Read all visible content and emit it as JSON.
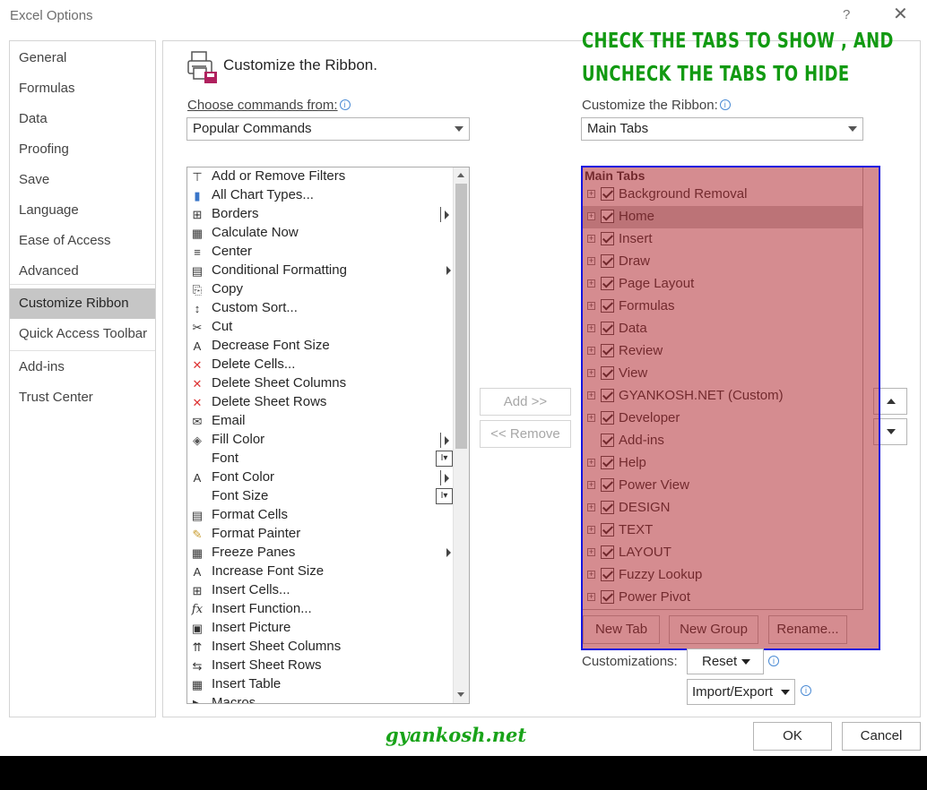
{
  "window": {
    "title": "Excel Options",
    "help": "?",
    "close": "✕"
  },
  "nav": {
    "items": [
      {
        "label": "General"
      },
      {
        "label": "Formulas"
      },
      {
        "label": "Data"
      },
      {
        "label": "Proofing"
      },
      {
        "label": "Save"
      },
      {
        "label": "Language"
      },
      {
        "label": "Ease of Access"
      },
      {
        "label": "Advanced"
      },
      {
        "label": "Customize Ribbon",
        "active": true
      },
      {
        "label": "Quick Access Toolbar"
      },
      {
        "label": "Add-ins"
      },
      {
        "label": "Trust Center"
      }
    ]
  },
  "main": {
    "heading": "Customize the Ribbon.",
    "choose_label": "Choose commands from:",
    "choose_value": "Popular Commands",
    "customize_label": "Customize the Ribbon:",
    "customize_value": "Main Tabs",
    "add_button": "Add >>",
    "remove_button": "<< Remove",
    "commands": [
      {
        "label": "Add or Remove Filters",
        "icon": "filter-icon",
        "glyph": "⊤"
      },
      {
        "label": "All Chart Types...",
        "icon": "chart-icon",
        "glyph": "▮"
      },
      {
        "label": "Borders",
        "icon": "borders-icon",
        "glyph": "⊞",
        "extra": "subbar"
      },
      {
        "label": "Calculate Now",
        "icon": "calculator-icon",
        "glyph": "▦"
      },
      {
        "label": "Center",
        "icon": "align-center-icon",
        "glyph": "≡"
      },
      {
        "label": "Conditional Formatting",
        "icon": "conditional-format-icon",
        "glyph": "▤",
        "extra": "sub"
      },
      {
        "label": "Copy",
        "icon": "copy-icon",
        "glyph": "⎘"
      },
      {
        "label": "Custom Sort...",
        "icon": "sort-icon",
        "glyph": "↕"
      },
      {
        "label": "Cut",
        "icon": "scissors-icon",
        "glyph": "✂"
      },
      {
        "label": "Decrease Font Size",
        "icon": "decrease-font-icon",
        "glyph": "A"
      },
      {
        "label": "Delete Cells...",
        "icon": "delete-cells-icon",
        "glyph": "✕"
      },
      {
        "label": "Delete Sheet Columns",
        "icon": "delete-columns-icon",
        "glyph": "✕"
      },
      {
        "label": "Delete Sheet Rows",
        "icon": "delete-rows-icon",
        "glyph": "✕"
      },
      {
        "label": "Email",
        "icon": "email-icon",
        "glyph": "✉"
      },
      {
        "label": "Fill Color",
        "icon": "fill-color-icon",
        "glyph": "◈",
        "extra": "subbar"
      },
      {
        "label": "Font",
        "icon": "font-icon",
        "glyph": "",
        "extra": "combo"
      },
      {
        "label": "Font Color",
        "icon": "font-color-icon",
        "glyph": "A",
        "extra": "subbar"
      },
      {
        "label": "Font Size",
        "icon": "font-size-icon",
        "glyph": "",
        "extra": "combo"
      },
      {
        "label": "Format Cells",
        "icon": "format-cells-icon",
        "glyph": "▤"
      },
      {
        "label": "Format Painter",
        "icon": "format-painter-icon",
        "glyph": "✎"
      },
      {
        "label": "Freeze Panes",
        "icon": "freeze-panes-icon",
        "glyph": "▦",
        "extra": "sub"
      },
      {
        "label": "Increase Font Size",
        "icon": "increase-font-icon",
        "glyph": "A"
      },
      {
        "label": "Insert Cells...",
        "icon": "insert-cells-icon",
        "glyph": "⊞"
      },
      {
        "label": "Insert Function...",
        "icon": "function-icon",
        "glyph": "fx"
      },
      {
        "label": "Insert Picture",
        "icon": "picture-icon",
        "glyph": "▣"
      },
      {
        "label": "Insert Sheet Columns",
        "icon": "insert-columns-icon",
        "glyph": "⇈"
      },
      {
        "label": "Insert Sheet Rows",
        "icon": "insert-rows-icon",
        "glyph": "⇆"
      },
      {
        "label": "Insert Table",
        "icon": "table-icon",
        "glyph": "▦"
      },
      {
        "label": "Macros",
        "icon": "macros-icon",
        "glyph": "▶"
      }
    ],
    "tabs_header": "Main Tabs",
    "tabs": [
      {
        "label": "Background Removal",
        "expand": true
      },
      {
        "label": "Home",
        "expand": true,
        "selected": true
      },
      {
        "label": "Insert",
        "expand": true
      },
      {
        "label": "Draw",
        "expand": true
      },
      {
        "label": "Page Layout",
        "expand": true
      },
      {
        "label": "Formulas",
        "expand": true
      },
      {
        "label": "Data",
        "expand": true
      },
      {
        "label": "Review",
        "expand": true
      },
      {
        "label": "View",
        "expand": true
      },
      {
        "label": "GYANKOSH.NET (Custom)",
        "expand": true
      },
      {
        "label": "Developer",
        "expand": true
      },
      {
        "label": "Add-ins",
        "expand": false
      },
      {
        "label": "Help",
        "expand": true
      },
      {
        "label": "Power View",
        "expand": true
      },
      {
        "label": "DESIGN",
        "expand": true
      },
      {
        "label": "TEXT",
        "expand": true
      },
      {
        "label": "LAYOUT",
        "expand": true
      },
      {
        "label": "Fuzzy Lookup",
        "expand": true
      },
      {
        "label": "Power Pivot",
        "expand": true
      }
    ],
    "new_tab": "New Tab",
    "new_group": "New Group",
    "rename": "Rename...",
    "customizations_label": "Customizations:",
    "reset": "Reset",
    "import_export": "Import/Export"
  },
  "annotation": {
    "line1": "CHECK THE TABS TO SHOW , AND",
    "line2": "UNCHECK THE TABS TO HIDE"
  },
  "watermark": "gyankosh.net",
  "footer": {
    "ok": "OK",
    "cancel": "Cancel"
  },
  "colors": {
    "highlight": "#b22e34",
    "highlight_border": "#1515e0",
    "annotation": "#129a12",
    "nav_active": "#c6c6c6"
  }
}
